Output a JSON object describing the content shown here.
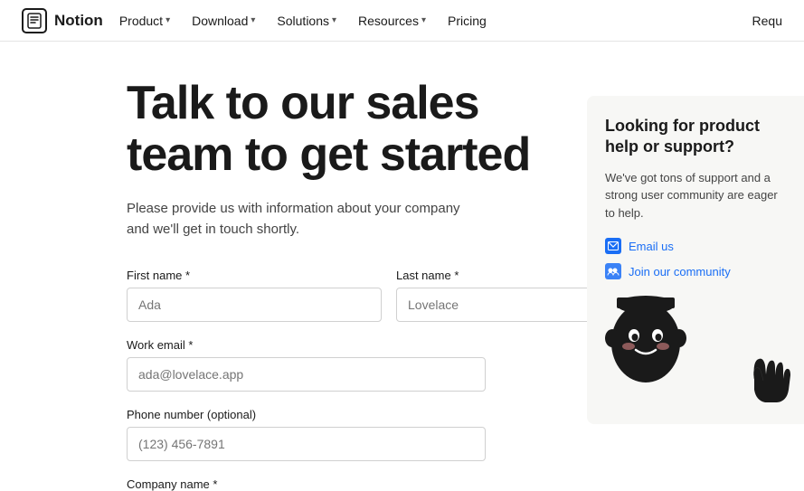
{
  "nav": {
    "logo_text": "Notion",
    "logo_letter": "N",
    "items": [
      {
        "label": "Product",
        "has_chevron": true
      },
      {
        "label": "Download",
        "has_chevron": true
      },
      {
        "label": "Solutions",
        "has_chevron": true
      },
      {
        "label": "Resources",
        "has_chevron": true
      },
      {
        "label": "Pricing",
        "has_chevron": false
      }
    ],
    "right_text": "Requ"
  },
  "hero": {
    "title_line1": "Talk to our sales",
    "title_line2": "team to get started",
    "subtitle": "Please provide us with information about your company and we'll get in touch shortly."
  },
  "form": {
    "first_name_label": "First name *",
    "first_name_placeholder": "Ada",
    "last_name_label": "Last name *",
    "last_name_placeholder": "Lovelace",
    "work_email_label": "Work email *",
    "work_email_placeholder": "ada@lovelace.app",
    "phone_label": "Phone number (optional)",
    "phone_placeholder": "(123) 456-7891",
    "company_label": "Company name *"
  },
  "side_panel": {
    "title": "Looking for product help or support?",
    "body": "We've got tons of support and a strong user community are eager to help.",
    "link1_label": "Email us",
    "link2_label": "Join our community"
  }
}
